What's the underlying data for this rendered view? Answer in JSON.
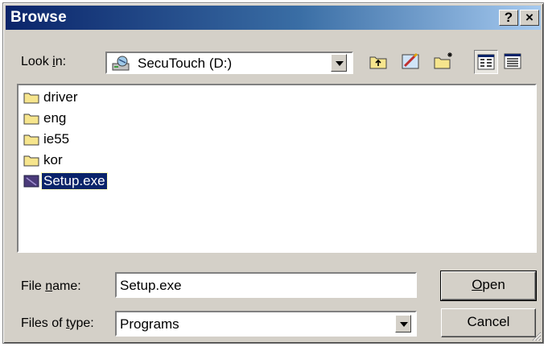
{
  "window": {
    "title": "Browse",
    "help_label": "?",
    "close_label": "×"
  },
  "lookin": {
    "label_pre": "Look ",
    "label_accel": "i",
    "label_post": "n:",
    "value": "SecuTouch (D:)",
    "icon": "drive-icon"
  },
  "toolbar": {
    "icons": [
      "up-one-level-icon",
      "desktop-icon",
      "new-folder-icon",
      "list-view-icon",
      "details-view-icon"
    ]
  },
  "files": [
    {
      "name": "driver",
      "type": "folder"
    },
    {
      "name": "eng",
      "type": "folder"
    },
    {
      "name": "ie55",
      "type": "folder"
    },
    {
      "name": "kor",
      "type": "folder"
    },
    {
      "name": "Setup.exe",
      "type": "exe",
      "selected": true
    }
  ],
  "filename": {
    "label_pre": "File ",
    "label_accel": "n",
    "label_post": "ame:",
    "value": "Setup.exe"
  },
  "filetype": {
    "label_pre": "Files of ",
    "label_accel": "t",
    "label_post": "ype:",
    "value": "Programs"
  },
  "buttons": {
    "open_accel": "O",
    "open_rest": "pen",
    "cancel": "Cancel"
  },
  "colors": {
    "titlebar": "#0a246a",
    "face": "#d4d0c8",
    "folder": "#f6e58d"
  }
}
